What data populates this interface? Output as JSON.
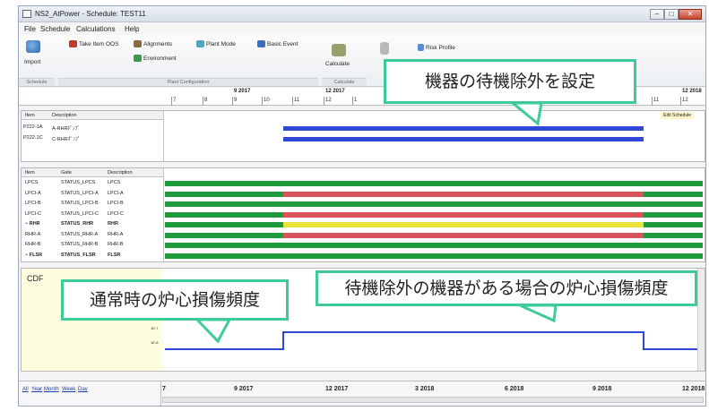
{
  "window": {
    "title": "NS2_AtPower - Schedule: TEST11"
  },
  "menu": [
    "File",
    "Schedule",
    "Calculations",
    "Help"
  ],
  "ribbon": {
    "import": "Import",
    "take_oos": "Take Item OOS",
    "alignments": "Alignments",
    "environment": "Environment",
    "plant_mode": "Plant Mode",
    "basic_event": "Basic Event",
    "calculate": "Calculate",
    "risk_profile": "Risk Profile",
    "groups": {
      "schedule": "Schedule",
      "plant_config": "Plant Configuration",
      "calculate": "Calculate"
    }
  },
  "timeline_top": {
    "months": [
      "9 2017",
      "12 2017",
      "12 2018"
    ],
    "ticks": [
      "7",
      "8",
      "9",
      "10",
      "11",
      "12",
      "1",
      "11",
      "12"
    ]
  },
  "oos_table": {
    "headers": [
      "Item",
      "Description"
    ],
    "rows": [
      {
        "item": "P222-1A",
        "desc": "A-RHRﾎﾟﾝﾌﾟ"
      },
      {
        "item": "P222-1C",
        "desc": "C-RHRﾎﾟﾝﾌﾟ"
      }
    ],
    "edit_schedule": "Edit Schedule",
    "bars": [
      {
        "start": 0.22,
        "end": 0.89,
        "color": "#2f47d6"
      },
      {
        "start": 0.22,
        "end": 0.89,
        "color": "#2f47d6"
      }
    ]
  },
  "gate_table": {
    "headers": [
      "Item",
      "Gate",
      "Description"
    ],
    "rows": [
      {
        "item": "LPCS",
        "gate": "STATUS_LPCS",
        "desc": "LPCS"
      },
      {
        "item": "LPCI-A",
        "gate": "STATUS_LPCI-A",
        "desc": "LPCI-A"
      },
      {
        "item": "LPCI-B",
        "gate": "STATUS_LPCI-B",
        "desc": "LPCI-B"
      },
      {
        "item": "LPCI-C",
        "gate": "STATUS_LPCI-C",
        "desc": "LPCI-C"
      },
      {
        "item": "− RHR",
        "gate": "STATUS_RHR",
        "desc": "RHR"
      },
      {
        "item": "RHR-A",
        "gate": "STATUS_RHR-A",
        "desc": "RHR-A"
      },
      {
        "item": "RHR-B",
        "gate": "STATUS_RHR-B",
        "desc": "RHR-B"
      },
      {
        "item": "− FLSR",
        "gate": "STATUS_FLSR",
        "desc": "FLSR"
      }
    ],
    "status_bars": [
      [
        {
          "start": 0,
          "end": 1,
          "color": "#1f9a3c"
        }
      ],
      [
        {
          "start": 0,
          "end": 0.22,
          "color": "#1f9a3c"
        },
        {
          "start": 0.22,
          "end": 0.89,
          "color": "#d9545a"
        },
        {
          "start": 0.89,
          "end": 1,
          "color": "#1f9a3c"
        }
      ],
      [
        {
          "start": 0,
          "end": 1,
          "color": "#1f9a3c"
        }
      ],
      [
        {
          "start": 0,
          "end": 0.22,
          "color": "#1f9a3c"
        },
        {
          "start": 0.22,
          "end": 0.89,
          "color": "#d9545a"
        },
        {
          "start": 0.89,
          "end": 1,
          "color": "#1f9a3c"
        }
      ],
      [
        {
          "start": 0,
          "end": 0.22,
          "color": "#1f9a3c"
        },
        {
          "start": 0.22,
          "end": 0.89,
          "color": "#e8e23a"
        },
        {
          "start": 0.89,
          "end": 1,
          "color": "#1f9a3c"
        }
      ],
      [
        {
          "start": 0,
          "end": 0.22,
          "color": "#1f9a3c"
        },
        {
          "start": 0.22,
          "end": 0.89,
          "color": "#d9545a"
        },
        {
          "start": 0.89,
          "end": 1,
          "color": "#1f9a3c"
        }
      ],
      [
        {
          "start": 0,
          "end": 1,
          "color": "#1f9a3c"
        }
      ],
      [
        {
          "start": 0,
          "end": 1,
          "color": "#1f9a3c"
        }
      ]
    ]
  },
  "cdf_panel": {
    "label": "CDF",
    "y_ticks": [
      "1E-6",
      "1E-7",
      "1E-8"
    ],
    "step": {
      "low_start": 0,
      "high_start": 0.22,
      "high_end": 0.89,
      "end": 1,
      "color": "#2f47d6"
    }
  },
  "callouts": {
    "set_standby": "機器の待機除外を設定",
    "normal_cdf": "通常時の炉心損傷頻度",
    "oos_cdf": "待機除外の機器がある場合の炉心損傷頻度",
    "color": "#3dcb9a"
  },
  "bottom_axis": {
    "zoom_links": [
      "All",
      "Year",
      "Month",
      "Week",
      "Day"
    ],
    "labels": [
      "7",
      "9 2017",
      "12 2017",
      "3 2018",
      "6 2018",
      "9 2018",
      "12 2018"
    ]
  }
}
